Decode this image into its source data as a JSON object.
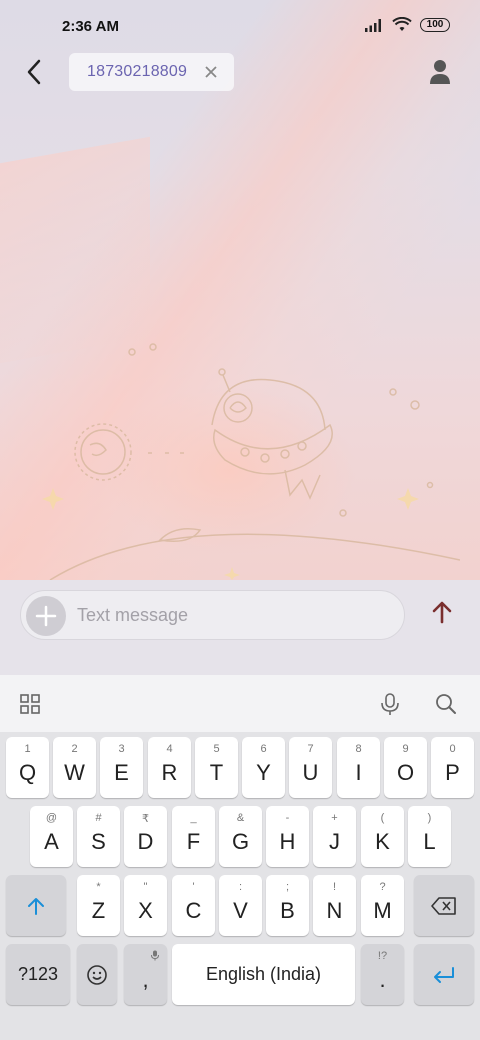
{
  "status_bar": {
    "time": "2:36 AM",
    "battery": "100",
    "icons": [
      "signal-icon",
      "wifi-icon",
      "battery-icon"
    ]
  },
  "header": {
    "back_icon": "back-arrow-icon",
    "recipient": "18730218809",
    "remove_icon": "close-icon",
    "contact_icon": "person-icon"
  },
  "compose": {
    "placeholder": "Text message",
    "attach_icon": "plus-icon",
    "send_icon": "send-arrow-icon",
    "send_color": "#7a2e2e"
  },
  "keyboard_toolbar": {
    "icons": [
      "apps-grid-icon",
      "microphone-icon",
      "search-icon"
    ]
  },
  "keyboard": {
    "row1": [
      {
        "key": "Q",
        "hint": "1"
      },
      {
        "key": "W",
        "hint": "2"
      },
      {
        "key": "E",
        "hint": "3"
      },
      {
        "key": "R",
        "hint": "4"
      },
      {
        "key": "T",
        "hint": "5"
      },
      {
        "key": "Y",
        "hint": "6"
      },
      {
        "key": "U",
        "hint": "7"
      },
      {
        "key": "I",
        "hint": "8"
      },
      {
        "key": "O",
        "hint": "9"
      },
      {
        "key": "P",
        "hint": "0"
      }
    ],
    "row2": [
      {
        "key": "A",
        "hint": "@"
      },
      {
        "key": "S",
        "hint": "#"
      },
      {
        "key": "D",
        "hint": "₹"
      },
      {
        "key": "F",
        "hint": "_"
      },
      {
        "key": "G",
        "hint": "&"
      },
      {
        "key": "H",
        "hint": "-"
      },
      {
        "key": "J",
        "hint": "+"
      },
      {
        "key": "K",
        "hint": "("
      },
      {
        "key": "L",
        "hint": ")"
      }
    ],
    "row3": [
      {
        "key": "Z",
        "hint": "*"
      },
      {
        "key": "X",
        "hint": "\""
      },
      {
        "key": "C",
        "hint": "'"
      },
      {
        "key": "V",
        "hint": ":"
      },
      {
        "key": "B",
        "hint": ";"
      },
      {
        "key": "N",
        "hint": "!"
      },
      {
        "key": "M",
        "hint": "?"
      }
    ],
    "shift_icon": "shift-arrow-icon",
    "backspace_icon": "backspace-icon",
    "symbols_label": "?123",
    "emoji_icon": "emoji-icon",
    "comma_label": ",",
    "space_label": "English (India)",
    "period_label": ".",
    "period_hint": "!?",
    "enter_icon": "enter-icon",
    "accent_color": "#1a8fd8"
  }
}
